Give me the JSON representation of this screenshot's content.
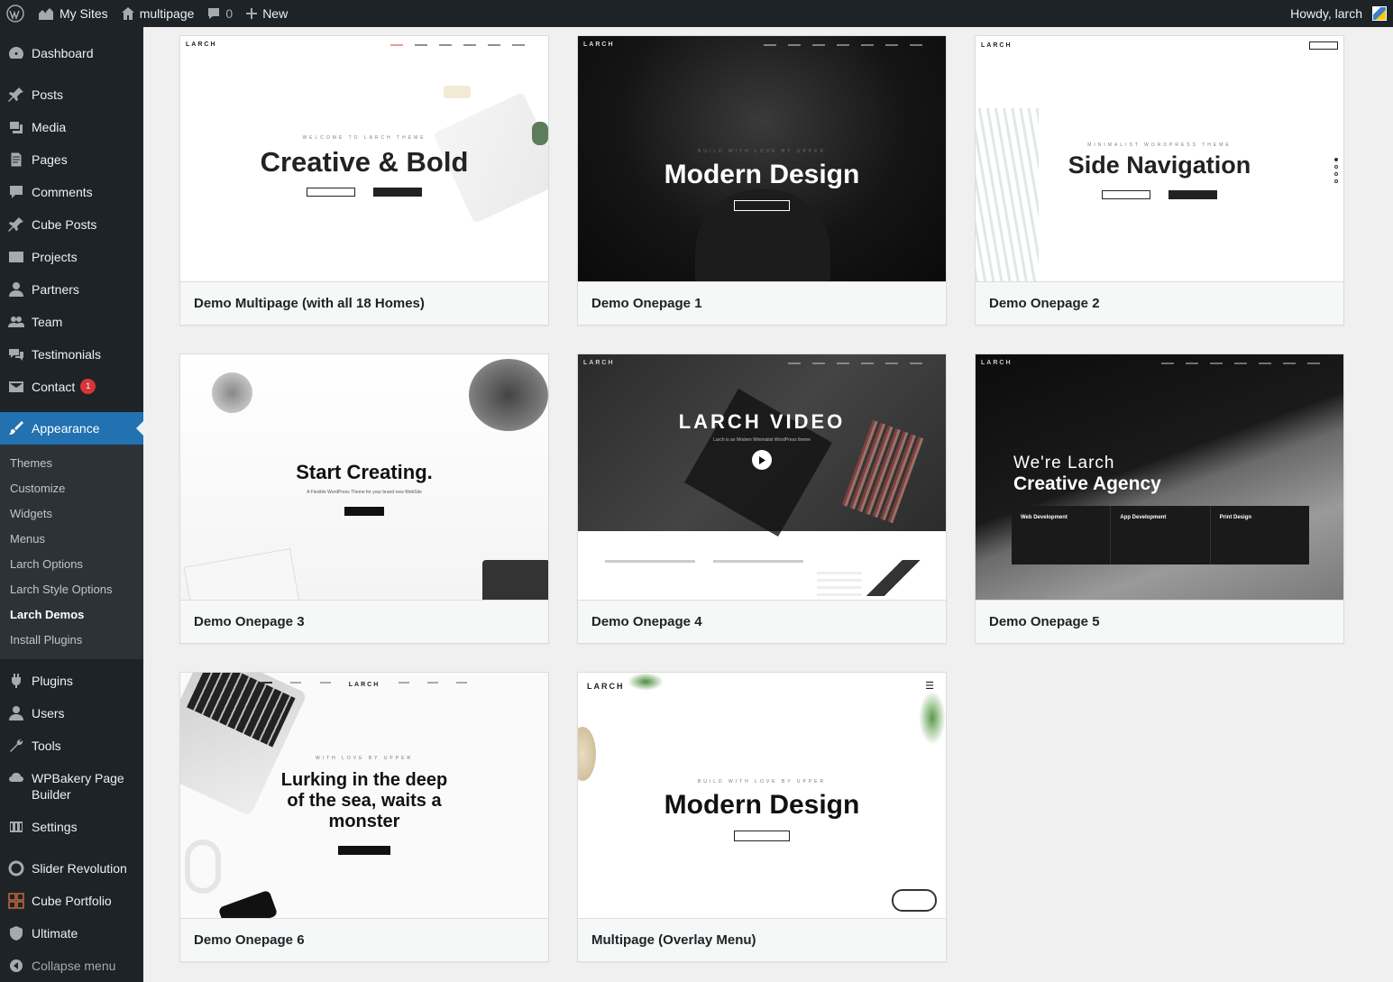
{
  "admin_bar": {
    "my_sites": "My Sites",
    "site_name": "multipage",
    "comments_count": "0",
    "new_label": "New",
    "howdy": "Howdy, larch"
  },
  "sidebar": {
    "dashboard": "Dashboard",
    "items_a": [
      "Posts",
      "Media",
      "Pages",
      "Comments",
      "Cube Posts",
      "Projects",
      "Partners",
      "Team",
      "Testimonials"
    ],
    "contact": "Contact",
    "contact_badge": "1",
    "appearance": "Appearance",
    "submenu": [
      "Themes",
      "Customize",
      "Widgets",
      "Menus",
      "Larch Options",
      "Larch Style Options",
      "Larch Demos",
      "Install Plugins"
    ],
    "current_submenu": "Larch Demos",
    "items_b": [
      "Plugins",
      "Users",
      "Tools",
      "WPBakery Page Builder",
      "Settings"
    ],
    "items_c": [
      "Slider Revolution",
      "Cube Portfolio",
      "Ultimate"
    ],
    "collapse": "Collapse menu"
  },
  "demos": [
    {
      "name": "Demo Multipage (with all 18 Homes)",
      "tag": "WELCOME TO LARCH THEME",
      "title": "Creative & Bold",
      "logo": "LARCH"
    },
    {
      "name": "Demo Onepage 1",
      "tag": "BUILD WITH LOVE BY UPPER",
      "title": "Modern Design",
      "logo": "LARCH"
    },
    {
      "name": "Demo Onepage 2",
      "tag": "MINIMALIST WORDPRESS THEME",
      "title": "Side Navigation",
      "logo": "LARCH"
    },
    {
      "name": "Demo Onepage 3",
      "tag": "A Flexible WordPress Theme for your brand new WebSite",
      "title": "Start Creating.",
      "logo": ""
    },
    {
      "name": "Demo Onepage 4",
      "tag": "Larch is an Modern Minimalist WordPress theme",
      "title": "LARCH VIDEO",
      "logo": "LARCH"
    },
    {
      "name": "Demo Onepage 5",
      "tag": "We're Larch",
      "title": "Creative Agency",
      "logo": "LARCH"
    },
    {
      "name": "Demo Onepage 6",
      "tag": "WITH LOVE BY UPPER",
      "title": "Lurking in the deep of the sea, waits a monster",
      "logo": "LARCH"
    },
    {
      "name": "Multipage (Overlay Menu)",
      "tag": "BUILD WITH LOVE BY UPPER",
      "title": "Modern Design",
      "logo": "LARCH"
    }
  ],
  "demo5_services": [
    "Web Development",
    "App Development",
    "Print Design"
  ],
  "colors": {
    "adminbar": "#1d2327",
    "accent": "#2271b1",
    "badge": "#d63638"
  }
}
